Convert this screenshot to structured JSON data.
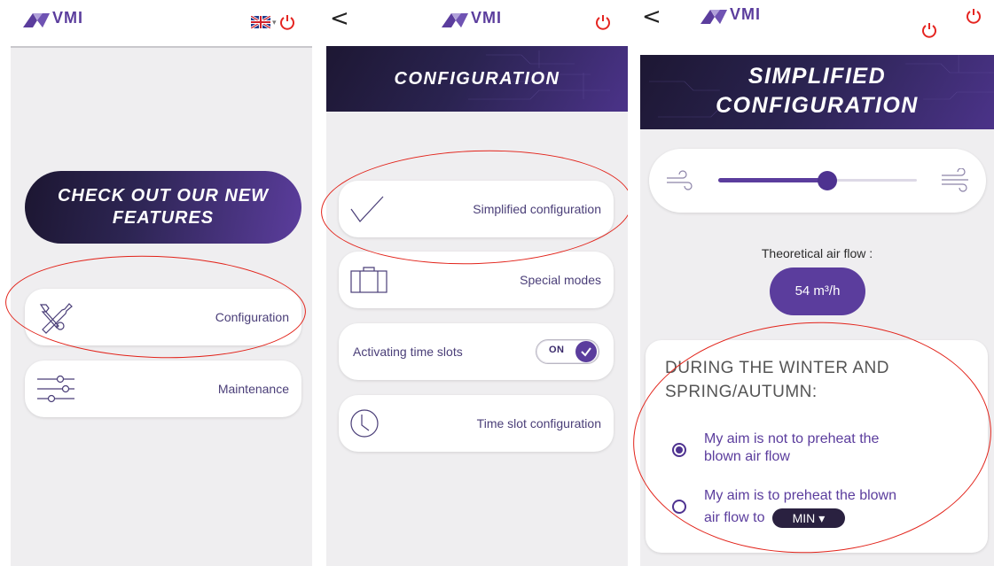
{
  "colors": {
    "brand_purple": "#5b3d9d",
    "brand_dark": "#1d1733",
    "power_red": "#e52521",
    "annotation_red": "#e2231a",
    "background_gray": "#efeef0"
  },
  "brand": {
    "logo_text": "VMI"
  },
  "screen_home": {
    "language": {
      "flag_icon": "uk-flag-icon",
      "caret": "▾"
    },
    "promo": {
      "line1": "CHECK OUT OUR NEW",
      "line2": "FEATURES"
    },
    "menu": [
      {
        "label": "Configuration",
        "icon": "tools-icon"
      },
      {
        "label": "Maintenance",
        "icon": "sliders-icon"
      }
    ]
  },
  "screen_configuration": {
    "back_label": "<",
    "header_title": "CONFIGURATION",
    "items": [
      {
        "label": "Simplified configuration",
        "icon": "checkmark-icon"
      },
      {
        "label": "Special modes",
        "icon": "suitcase-icon"
      }
    ],
    "time_slots_toggle": {
      "label": "Activating time slots",
      "state": "ON"
    },
    "time_slot_config": {
      "label": "Time slot configuration",
      "icon": "clock-icon"
    }
  },
  "screen_simplified": {
    "back_label": "<",
    "header_line1": "SIMPLIFIED",
    "header_line2": "CONFIGURATION",
    "fan_slider": {
      "level": 0.55,
      "low_icon": "wind-low-icon",
      "high_icon": "wind-high-icon"
    },
    "airflow_label": "Theoretical air flow :",
    "airflow_value": "54 m³/h",
    "season": {
      "title_line1": "DURING THE WINTER AND",
      "title_line2": "SPRING/AUTUMN:",
      "option1_line1": "My aim is not to preheat the",
      "option1_line2": "blown air flow",
      "option1_selected": true,
      "option2_line1": "My aim is to preheat the blown",
      "option2_line2": "air flow to",
      "option2_selected": false,
      "preheat_level": "MIN",
      "preheat_caret": "▾"
    }
  }
}
